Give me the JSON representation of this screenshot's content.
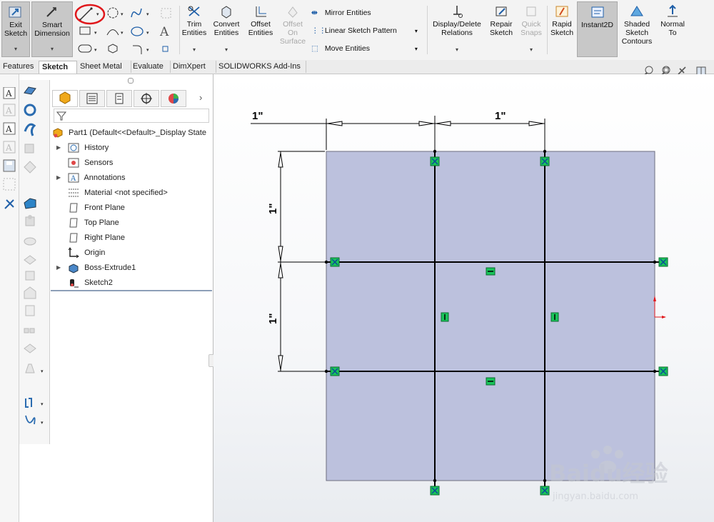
{
  "ribbon": {
    "exit_sketch": "Exit\nSketch",
    "smart_dimension": "Smart\nDimension",
    "trim_entities": "Trim\nEntities",
    "convert_entities": "Convert\nEntities",
    "offset_entities": "Offset\nEntities",
    "offset_on_surface": "Offset\nOn\nSurface",
    "mirror_entities": "Mirror Entities",
    "linear_sketch_pattern": "Linear Sketch Pattern",
    "move_entities": "Move Entities",
    "display_delete_relations": "Display/Delete\nRelations",
    "repair_sketch": "Repair\nSketch",
    "quick_snaps": "Quick\nSnaps",
    "rapid_sketch": "Rapid\nSketch",
    "instant2d": "Instant2D",
    "shaded_sketch_contours": "Shaded\nSketch\nContours",
    "normal_to": "Normal\nTo"
  },
  "tabs": [
    "Features",
    "Sketch",
    "Sheet Metal",
    "Evaluate",
    "DimXpert",
    "SOLIDWORKS Add-Ins"
  ],
  "active_tab": "Sketch",
  "tree": {
    "root": "Part1  (Default<<Default>_Display State",
    "items": [
      "History",
      "Sensors",
      "Annotations",
      "Material <not specified>",
      "Front Plane",
      "Top Plane",
      "Right Plane",
      "Origin",
      "Boss-Extrude1",
      "Sketch2"
    ]
  },
  "dimensions": {
    "top_left": "1\"",
    "top_right": "1\"",
    "left_upper": "1\"",
    "left_lower": "1\""
  },
  "colors": {
    "face": "#bcc1dd",
    "relation_green": "#19c45a",
    "highlight_circle": "#e0181c"
  },
  "watermark": {
    "brand": "Baidu经验",
    "url": "jingyan.baidu.com"
  }
}
